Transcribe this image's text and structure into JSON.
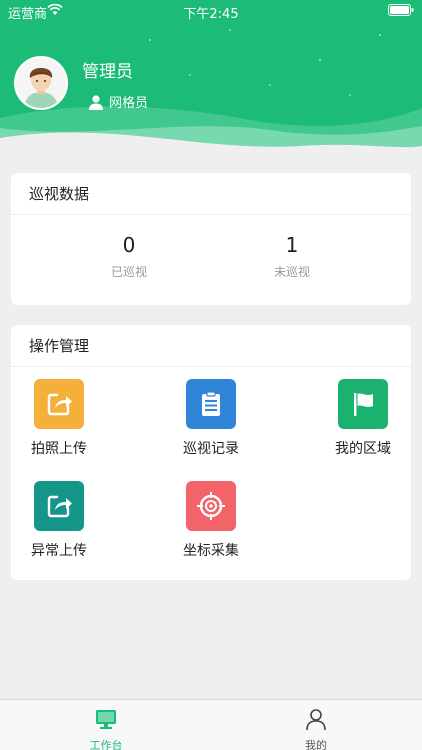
{
  "status_bar": {
    "carrier": "运营商",
    "time": "下午2:45"
  },
  "user": {
    "name": "管理员",
    "role": "网格员"
  },
  "patrol_card": {
    "title": "巡视数据",
    "stats": [
      {
        "value": "0",
        "label": "已巡视"
      },
      {
        "value": "1",
        "label": "未巡视"
      }
    ]
  },
  "ops_card": {
    "title": "操作管理",
    "items": [
      {
        "label": "拍照上传",
        "icon": "share-upload-icon",
        "color": "#f5b03c"
      },
      {
        "label": "巡视记录",
        "icon": "clipboard-icon",
        "color": "#2f86d8"
      },
      {
        "label": "我的区域",
        "icon": "flag-icon",
        "color": "#1bb270"
      },
      {
        "label": "异常上传",
        "icon": "share-upload-icon",
        "color": "#14968a"
      },
      {
        "label": "坐标采集",
        "icon": "target-icon",
        "color": "#f2636a"
      }
    ]
  },
  "tabbar": {
    "tabs": [
      {
        "label": "工作台",
        "icon": "monitor-icon",
        "active": true
      },
      {
        "label": "我的",
        "icon": "person-icon",
        "active": false
      }
    ]
  },
  "colors": {
    "brand": "#1cbb78",
    "background": "#efefef"
  }
}
